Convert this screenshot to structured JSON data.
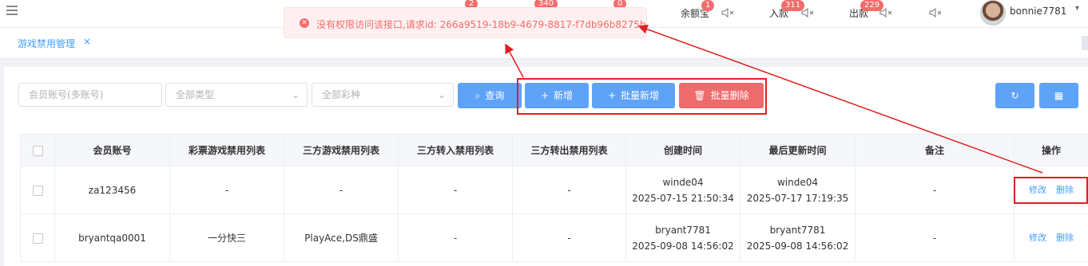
{
  "topbar": {
    "balance_label": "余额宝",
    "deposit_label": "入款",
    "withdraw_label": "出款",
    "badges": [
      "2",
      "340",
      "0",
      "1",
      "311",
      "229"
    ],
    "username": "bonnie7781",
    "menu_icon": "hamburger-icon",
    "sound_icon": "speaker-muted-icon"
  },
  "tabs": [
    {
      "label": "游戏禁用管理",
      "close": "×"
    }
  ],
  "toast": {
    "type": "error",
    "message": "没有权限访问该接口,请求id: 266a9519-18b9-4679-8817-f7db96b8275b"
  },
  "filters": {
    "account_placeholder": "会员账号(多账号)",
    "type_placeholder": "全部类型",
    "lottery_placeholder": "全部彩种"
  },
  "buttons": {
    "query": "查询",
    "add": "新增",
    "batch_add": "批量新增",
    "batch_delete": "批量删除"
  },
  "table": {
    "headers": [
      "会员账号",
      "彩票游戏禁用列表",
      "三方游戏禁用列表",
      "三方转入禁用列表",
      "三方转出禁用列表",
      "创建时间",
      "最后更新时间",
      "备注",
      "操作"
    ],
    "rows": [
      {
        "account": "za123456",
        "lottery": "-",
        "third_game": "-",
        "third_in": "-",
        "third_out": "-",
        "creator": "winde04",
        "created": "2025-07-15 21:50:34",
        "updater": "winde04",
        "updated": "2025-07-17 17:19:35",
        "note": "-",
        "edit": "修改",
        "delete": "删除"
      },
      {
        "account": "bryantqa0001",
        "lottery": "一分快三",
        "third_game": "PlayAce,DS鼎盛",
        "third_in": "-",
        "third_out": "-",
        "creator": "bryant7781",
        "created": "2025-09-08 14:56:02",
        "updater": "bryant7781",
        "updated": "2025-09-08 14:56:02",
        "note": "-",
        "edit": "修改",
        "delete": "删除"
      }
    ]
  },
  "colors": {
    "primary": "#409eff",
    "danger": "#f56c6c",
    "annotation": "#e02020"
  }
}
